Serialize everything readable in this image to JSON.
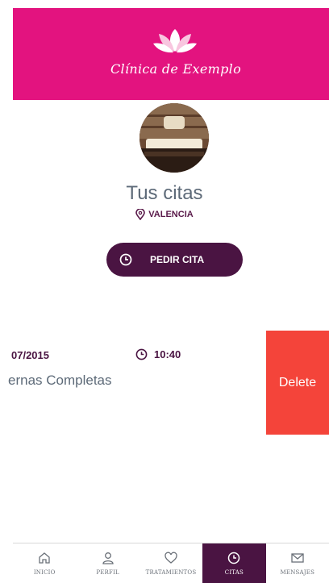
{
  "header": {
    "brand_name": "Clínica de Exemplo",
    "logo_icon": "lotus-icon",
    "background_color": "#e3137f"
  },
  "profile": {
    "avatar": "spa-treatment-photo",
    "title": "Tus citas",
    "location_icon": "map-pin-icon",
    "location": "VALENCIA"
  },
  "actions": {
    "book_icon": "clock-icon",
    "book_label": "PEDIR CITA",
    "book_color": "#4a1442"
  },
  "appointments": [
    {
      "date": "07/2015",
      "time_icon": "clock-icon",
      "time": "10:40",
      "treatment": "ernas Completas",
      "delete_label": "Delete",
      "delete_color": "#f4443a"
    }
  ],
  "tabbar": {
    "active_tab": "CITAS",
    "tabs": [
      {
        "label": "INICIO",
        "icon": "home-icon"
      },
      {
        "label": "PERFIL",
        "icon": "user-icon"
      },
      {
        "label": "TRATAMIENTOS",
        "icon": "heart-icon"
      },
      {
        "label": "CITAS",
        "icon": "clock-icon"
      },
      {
        "label": "MENSAJES",
        "icon": "mail-icon"
      }
    ]
  }
}
